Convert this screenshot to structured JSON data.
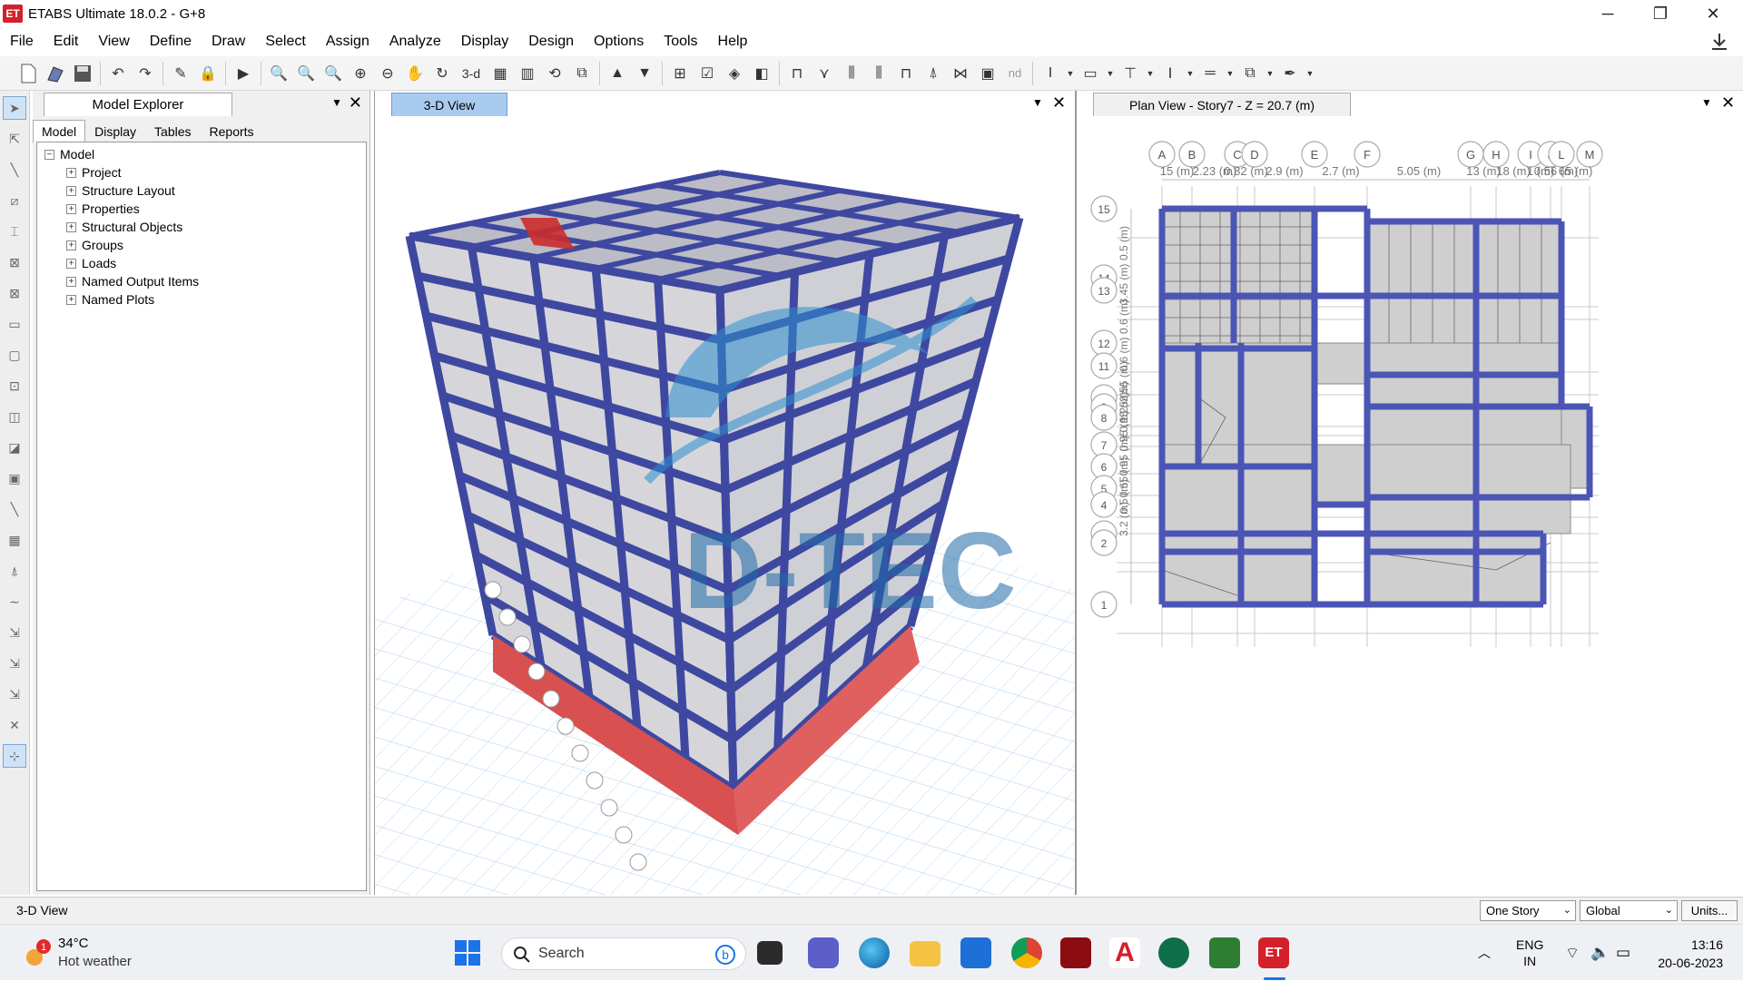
{
  "window": {
    "title": "ETABS Ultimate 18.0.2 - G+8",
    "app_badge": "ET"
  },
  "menu": [
    "File",
    "Edit",
    "View",
    "Define",
    "Draw",
    "Select",
    "Assign",
    "Analyze",
    "Display",
    "Design",
    "Options",
    "Tools",
    "Help"
  ],
  "toolbar": {
    "view_3d_label": "3-d",
    "nd_label": "nd"
  },
  "explorer": {
    "title": "Model Explorer",
    "tabs": [
      "Model",
      "Display",
      "Tables",
      "Reports"
    ],
    "root": "Model",
    "items": [
      "Project",
      "Structure Layout",
      "Properties",
      "Structural Objects",
      "Groups",
      "Loads",
      "Named Output Items",
      "Named Plots"
    ]
  },
  "view3d": {
    "tab": "3-D View",
    "watermark": "D-TEC"
  },
  "plan": {
    "tab": "Plan View - Story7 - Z = 20.7 (m)",
    "grid_x": [
      "A",
      "B",
      "C",
      "D",
      "E",
      "F",
      "G",
      "H",
      "I",
      "J",
      "L",
      "M"
    ],
    "grid_y": [
      "15",
      "14",
      "13",
      "12",
      "11",
      "10",
      "9",
      "8",
      "7",
      "6",
      "5",
      "4",
      "3",
      "2",
      "1"
    ],
    "dims_x": [
      "15 (m)",
      "2.23 (m)",
      "0.82 (m)",
      "2.9 (m)",
      "2.7 (m)",
      "5.05 (m)",
      "13 (m)",
      "18 (m)",
      "1 (m)",
      "0.56 (m)",
      "65 (m)"
    ],
    "dims_y": [
      "0.5 (m)",
      "3.45 (m)",
      "0.6 (m)",
      "0.6 (m)",
      "2.55 (m)",
      "1.25 (m)",
      "0.95 (m)",
      "0.95 (m)",
      "0.95 (m)",
      "0.65 (m)",
      "0.5 (m)",
      "3.2 (m)"
    ]
  },
  "status": {
    "view": "3-D View",
    "story": "One Story",
    "coord": "Global",
    "units": "Units..."
  },
  "taskbar": {
    "weather_temp": "34°C",
    "weather_desc": "Hot weather",
    "weather_badge": "1",
    "search": "Search",
    "lang": "ENG",
    "region": "IN",
    "time": "13:16",
    "date": "20-06-2023"
  },
  "colors": {
    "frame": "#3f48a0",
    "base": "#e06060",
    "grid": "#9ec7ea",
    "slab": "#c9c9c9"
  }
}
